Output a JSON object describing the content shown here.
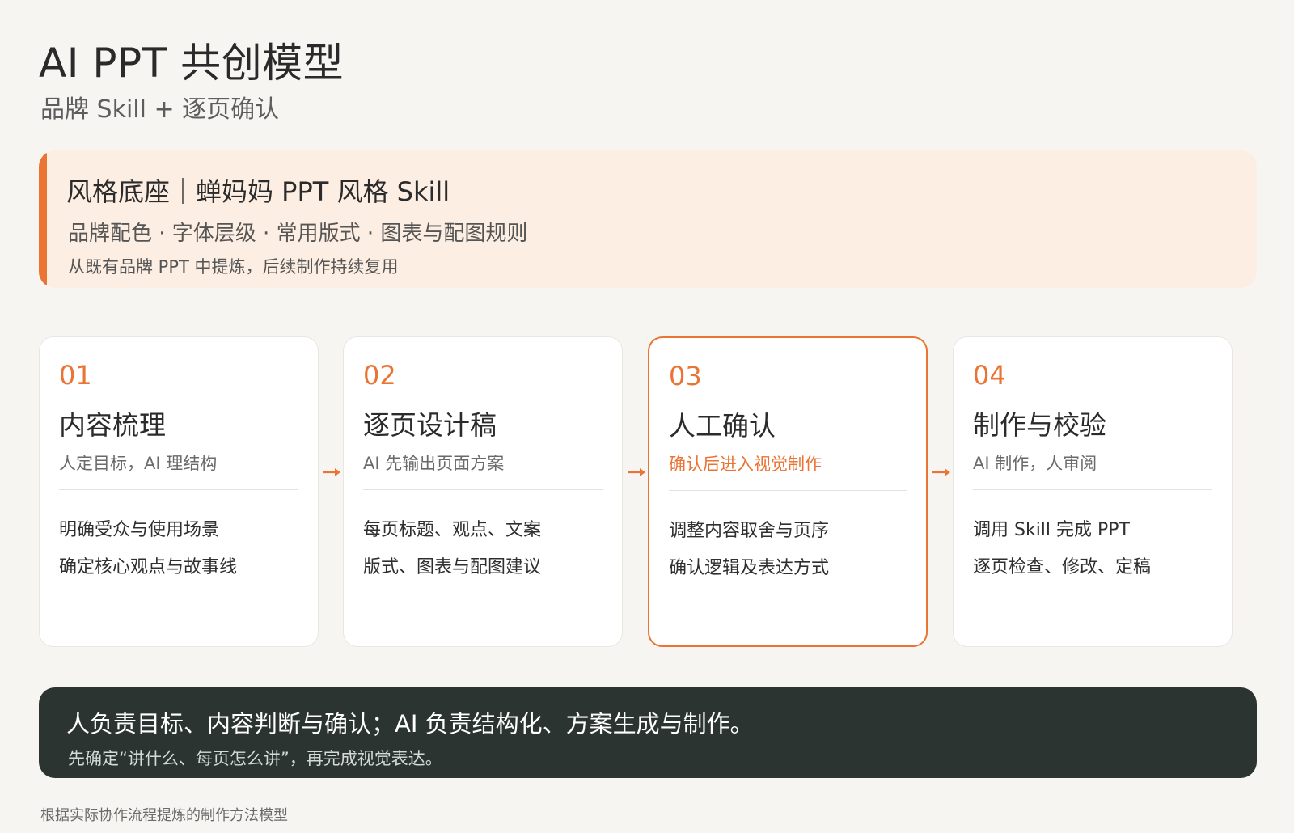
{
  "header": {
    "title": "AI PPT 共创模型",
    "subtitle": "品牌 Skill + 逐页确认"
  },
  "banner": {
    "title": "风格底座｜蝉妈妈 PPT 风格 Skill",
    "features": "品牌配色 · 字体层级 · 常用版式 · 图表与配图规则",
    "note": "从既有品牌 PPT 中提炼，后续制作持续复用"
  },
  "steps": [
    {
      "num": "01",
      "title": "内容梳理",
      "subtitle": "人定目标，AI 理结构",
      "bullets": [
        "明确受众与使用场景",
        "确定核心观点与故事线"
      ]
    },
    {
      "num": "02",
      "title": "逐页设计稿",
      "subtitle": "AI 先输出页面方案",
      "bullets": [
        "每页标题、观点、文案",
        "版式、图表与配图建议"
      ]
    },
    {
      "num": "03",
      "title": "人工确认",
      "subtitle": "确认后进入视觉制作",
      "bullets": [
        "调整内容取舍与页序",
        "确认逻辑及表达方式"
      ]
    },
    {
      "num": "04",
      "title": "制作与校验",
      "subtitle": "AI 制作，人审阅",
      "bullets": [
        "调用 Skill 完成 PPT",
        "逐页检查、修改、定稿"
      ]
    }
  ],
  "summary": {
    "main": "人负责目标、内容判断与确认；AI 负责结构化、方案生成与制作。",
    "sub": "先确定“讲什么、每页怎么讲”，再完成视觉表达。"
  },
  "footnote": "根据实际协作流程提炼的制作方法模型",
  "colors": {
    "accent": "#ea7434",
    "banner_bg": "#fdeee3",
    "summary_bg": "#2c3431",
    "page_bg": "#f7f5f1"
  }
}
